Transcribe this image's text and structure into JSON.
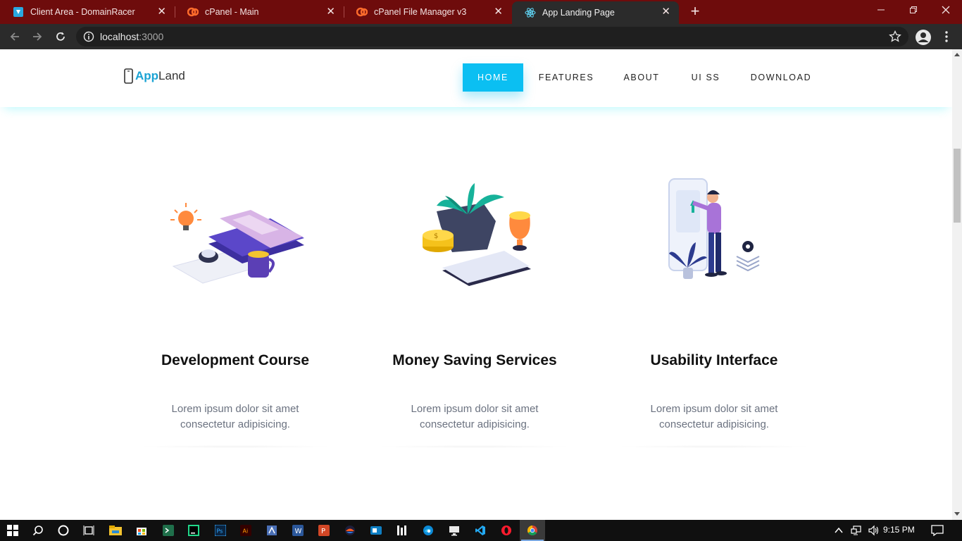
{
  "browser": {
    "tabs": [
      {
        "title": "Client Area - DomainRacer",
        "icon": "domainracer-icon"
      },
      {
        "title": "cPanel - Main",
        "icon": "cpanel-icon"
      },
      {
        "title": "cPanel File Manager v3",
        "icon": "cpanel-icon"
      },
      {
        "title": "App Landing Page",
        "icon": "react-icon",
        "active": true
      }
    ],
    "close_glyph": "✕",
    "new_tab_glyph": "+",
    "url_host": "localhost",
    "url_port": ":3000"
  },
  "site": {
    "logo_app": "App",
    "logo_land": "Land",
    "nav": [
      {
        "label": "HOME",
        "active": true
      },
      {
        "label": "FEATURES"
      },
      {
        "label": "ABOUT"
      },
      {
        "label": "UI SS"
      },
      {
        "label": "DOWNLOAD"
      }
    ],
    "features": [
      {
        "title": "Development Course",
        "text": "Lorem ipsum dolor sit amet consectetur adipisicing.",
        "illustration": "books-desk-illustration"
      },
      {
        "title": "Money Saving Services",
        "text": "Lorem ipsum dolor sit amet consectetur adipisicing.",
        "illustration": "plant-coins-illustration"
      },
      {
        "title": "Usability Interface",
        "text": "Lorem ipsum dolor sit amet consectetur adipisicing.",
        "illustration": "person-screen-illustration"
      }
    ]
  },
  "taskbar": {
    "time": "9:15 PM",
    "apps": [
      "windows-start-icon",
      "search-icon",
      "cortana-icon",
      "task-view-icon",
      "file-explorer-icon",
      "store-icon",
      "terminal-icon",
      "pycharm-icon",
      "photoshop-icon",
      "illustrator-icon",
      "git-icon",
      "word-icon",
      "powerpoint-icon",
      "figma-icon",
      "outlook-icon",
      "ide-icon",
      "edge-icon",
      "remote-desktop-icon",
      "vscode-icon",
      "opera-icon",
      "chrome-icon"
    ]
  },
  "colors": {
    "tabbar": "#6e0c0c",
    "toolbar": "#2b2b2b",
    "accent": "#0bbff2",
    "logo_app": "#1aa3d4"
  }
}
